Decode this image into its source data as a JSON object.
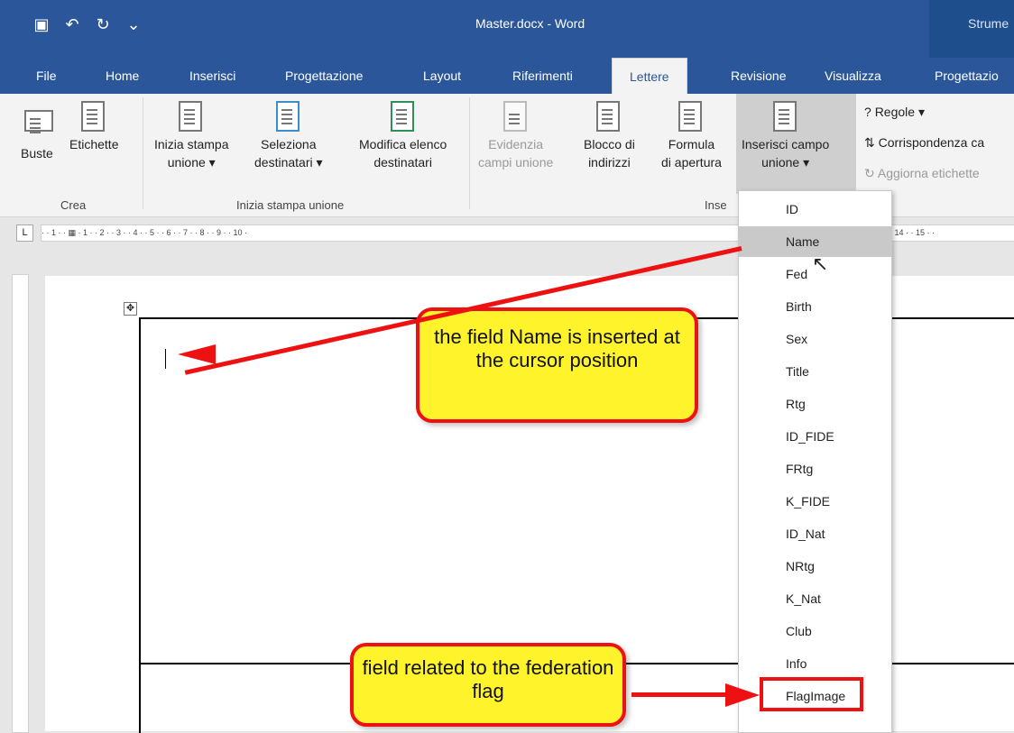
{
  "window": {
    "title": "Master.docx - Word",
    "contextual_tab_label": "Strume",
    "quick_access": [
      "save-icon",
      "undo-icon",
      "redo-icon",
      "customize-icon"
    ]
  },
  "tabs": [
    "File",
    "Home",
    "Inserisci",
    "Progettazione",
    "Layout",
    "Riferimenti",
    "Lettere",
    "Revisione",
    "Visualizza",
    "Progettazio"
  ],
  "ribbon": {
    "groups": {
      "crea": "Crea",
      "inizia": "Inizia stampa unione",
      "inserisci": "Inse"
    },
    "commands": {
      "buste": "Buste",
      "etichette": "Etichette",
      "inizia_1": "Inizia stampa",
      "inizia_2": "unione ▾",
      "seleziona_1": "Seleziona",
      "seleziona_2": "destinatari ▾",
      "modifica_1": "Modifica elenco",
      "modifica_2": "destinatari",
      "evidenzia_1": "Evidenzia",
      "evidenzia_2": "campi unione",
      "blocco_1": "Blocco di",
      "blocco_2": "indirizzi",
      "formula_1": "Formula",
      "formula_2": "di apertura",
      "inserisci_1": "Inserisci campo",
      "inserisci_2": "unione ▾",
      "regole": "Regole ▾",
      "corrispondenza": "Corrispondenza ca",
      "aggiorna": "Aggiorna etichette"
    }
  },
  "ruler": {
    "horizontal": "· · 1 · · ▦ · 1 · · 2 · · 3 · · 4 · · 5 · · 6 · · 7 · · 8 · · 9 · · 10 ·",
    "horizontal_right": "· 14 · · 15 · ·"
  },
  "dropdown": {
    "items": [
      "ID",
      "Name",
      "Fed",
      "Birth",
      "Sex",
      "Title",
      "Rtg",
      "ID_FIDE",
      "FRtg",
      "K_FIDE",
      "ID_Nat",
      "NRtg",
      "K_Nat",
      "Club",
      "Info",
      "FlagImage"
    ],
    "selected": "Name"
  },
  "callouts": {
    "name": "the field Name is inserted at the cursor position",
    "flag": "field related to the federation flag"
  },
  "colors": {
    "word_blue": "#2b579a",
    "ribbon": "#f3f3f3",
    "callout_fill": "#fff32b",
    "callout_border": "#e11111"
  }
}
